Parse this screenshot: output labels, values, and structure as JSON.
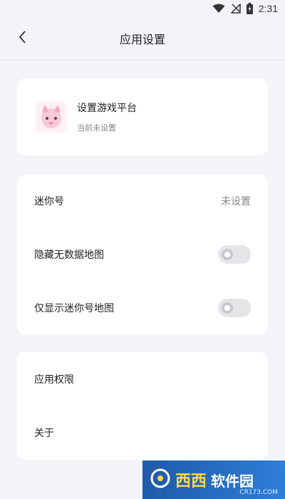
{
  "status_bar": {
    "time": "2:31",
    "icons": [
      "wifi-icon",
      "no-signal-icon",
      "battery-charging-icon"
    ]
  },
  "app_bar": {
    "title": "应用设置",
    "back_icon": "chevron-left-icon"
  },
  "platform_card": {
    "title": "设置游戏平台",
    "subtitle": "当前未设置"
  },
  "settings": {
    "mini_id_label": "迷你号",
    "mini_id_value": "未设置",
    "hide_no_data_label": "隐藏无数据地图",
    "hide_no_data_on": false,
    "only_mini_label": "仅显示迷你号地图",
    "only_mini_on": false
  },
  "about_card": {
    "permissions_label": "应用权限",
    "about_label": "关于"
  },
  "watermark": {
    "main": "西西",
    "main2": "软件园",
    "sub": "CR173.COM"
  },
  "colors": {
    "background": "#f3f4f8",
    "card": "#ffffff",
    "toggle_off": "#e5e5e8"
  }
}
